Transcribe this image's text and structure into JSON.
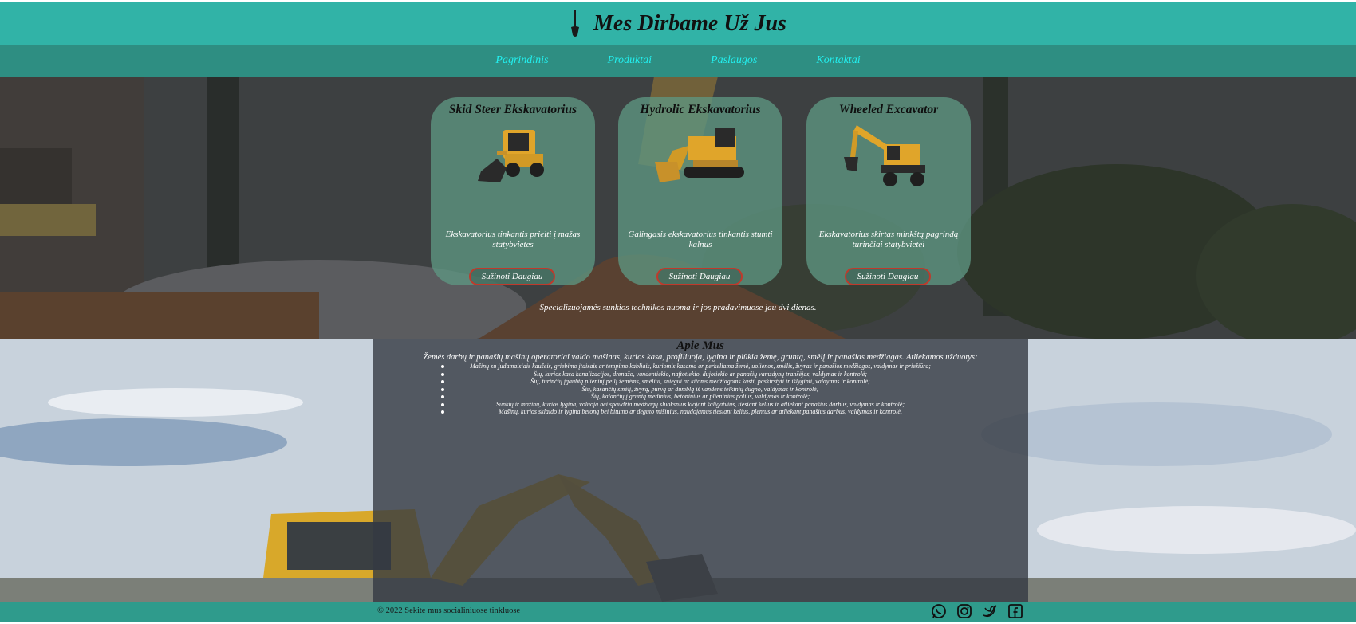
{
  "header": {
    "title": "Mes Dirbame Už Jus",
    "logo_icon": "shovel-icon"
  },
  "nav": {
    "items": [
      {
        "label": "Pagrindinis"
      },
      {
        "label": "Produktai"
      },
      {
        "label": "Paslaugos"
      },
      {
        "label": "Kontaktai"
      }
    ]
  },
  "hero": {
    "cards": [
      {
        "title": "Skid Steer Ekskavatorius",
        "description": "Ekskavatorius tinkantis prieiti į mažas statybvietes",
        "button": "Sužinoti Daugiau",
        "image_icon": "skid-steer-loader-image"
      },
      {
        "title": "Hydrolic Ekskavatorius",
        "description": "Galingasis ekskavatorius tinkantis stumti kalnus",
        "button": "Sužinoti Daugiau",
        "image_icon": "crawler-excavator-image"
      },
      {
        "title": "Wheeled Excavator",
        "description": "Ekskavatorius skirtas minkštą pagrindą turinčiai statybvietei",
        "button": "Sužinoti Daugiau",
        "image_icon": "wheeled-excavator-image"
      }
    ],
    "caption": "Specializuojamės sunkios technikos nuoma ir jos pradavimuose jau dvi dienas."
  },
  "about": {
    "title": "Apie Mus",
    "intro": "Žemės darbų ir panašių mašinų operatoriai valdo mašinas, kurios kasa, profiliuoja, lygina ir plūkia žemę, gruntą, smėlį ir panašias medžiagas. Atliekamos užduotys:",
    "items": [
      "Mašinų su judamaisiais kaušeis, griebimo įtaisais ar tempimo kabliais, kuriomis kasama ar perkeliama žemė, uolienos, smėlis, žvyras ir panašios medžiagos, valdymas ir priežiūra;",
      "Šių, kurios kasa kanalizacijos, drenažo, vandentiekio, naftotiekio, dujotiekio ar panašių vamzdynų tranšėjas, valdymas ir kontrolė;",
      "Šių, turinčių įgaubtą plieninį peilį žemėms, smėliui, sniegui ar kitoms medžiagoms kasti, paskirstyti ir išlyginti, valdymas ir kontrolė;",
      "Šių, kasančių smėlį, žvyrą, purvą ar dumblą iš vandens telkinių dugno, valdymas ir kontrolė;",
      "Šių, kalančių į gruntą medinius, betoninius ar plieninius polius, valdymas ir kontrolė;",
      "Sunkių ir mažinų, kurios lygina, voluoja bei spaudžia medžiagų sluoksnius klojant šaligatvius, tiesiant kelius ir atliekant panašius darbus, valdymas ir kontrolė;",
      "Mašinų, kurios sklaido ir lygina betoną bei bitumo ar deguto mišinius, naudojamus tiesiant kelius, plentus ar atliekant panašius darbus, valdymas ir kontrolė."
    ]
  },
  "footer": {
    "text": "© 2022 Sekite mus socialiniuose tinkluose",
    "social_icons": [
      "whatsapp-icon",
      "instagram-icon",
      "twitter-icon",
      "facebook-icon"
    ]
  },
  "colors": {
    "header_bg": "#31b3a7",
    "nav_bg": "#2e8e82",
    "nav_link": "#22f0f0",
    "card_bg": "#5e9682",
    "button_border": "#c0392b",
    "footer_bg": "#2f9b8c"
  }
}
